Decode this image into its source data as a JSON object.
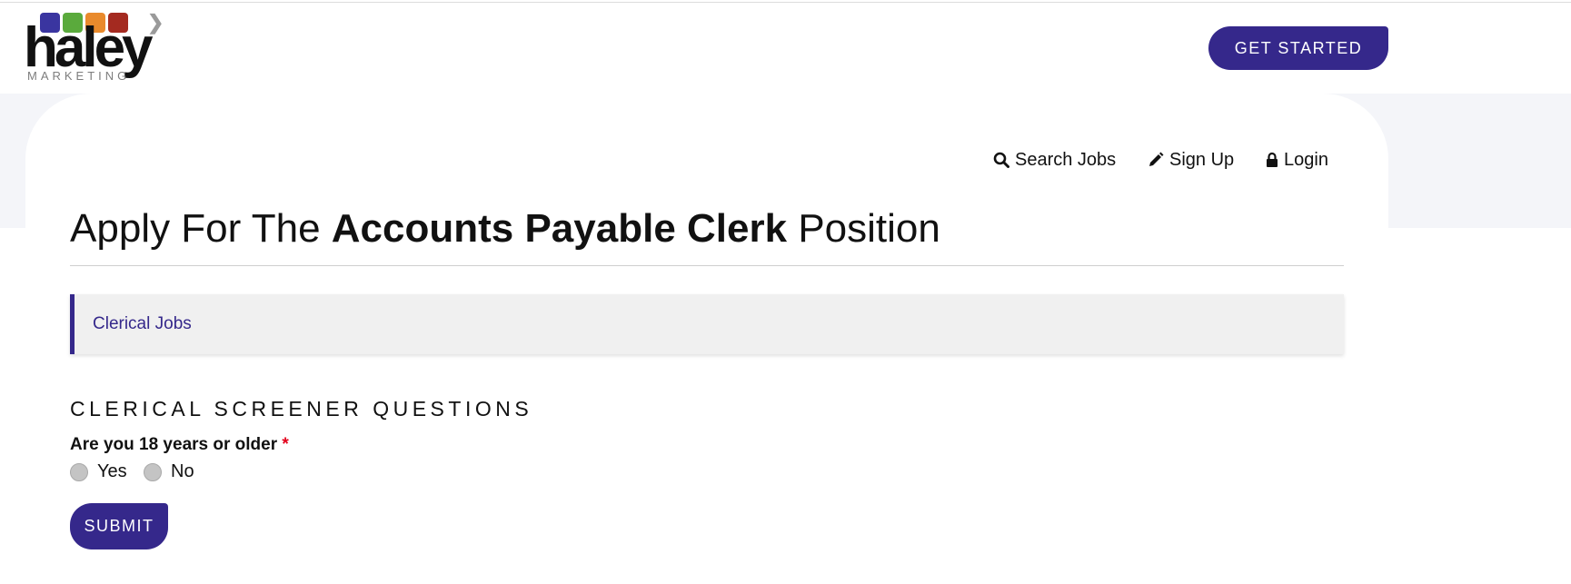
{
  "header": {
    "logo": {
      "word": "haley",
      "sub": "MARKETING",
      "icon_colors": [
        "#3a35a0",
        "#5aaa3c",
        "#e98a2c",
        "#a42a20"
      ]
    },
    "get_started_label": "GET STARTED"
  },
  "nav": {
    "search_jobs": "Search Jobs",
    "sign_up": "Sign Up",
    "login": "Login"
  },
  "page": {
    "title_prefix": "Apply For The ",
    "title_job": "Accounts Payable Clerk",
    "title_suffix": " Position",
    "category": "Clerical Jobs"
  },
  "form": {
    "section_heading": "CLERICAL SCREENER QUESTIONS",
    "question": "Are you 18 years or older",
    "required_mark": "*",
    "options": [
      "Yes",
      "No"
    ],
    "submit_label": "SUBMIT"
  },
  "colors": {
    "accent": "#35288b",
    "required": "#e3001b"
  }
}
